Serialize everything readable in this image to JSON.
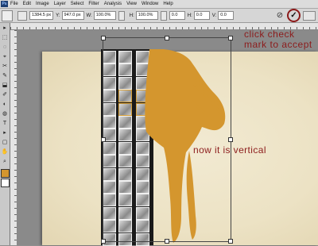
{
  "menubar": {
    "logo": "Ps",
    "items": [
      "File",
      "Edit",
      "Image",
      "Layer",
      "Select",
      "Filter",
      "Analysis",
      "View",
      "Window",
      "Help"
    ]
  },
  "options": {
    "x_value": "1384.5 px",
    "y_label": "Y:",
    "y_value": "947.0 px",
    "w_label": "W:",
    "w_value": "100.0%",
    "h_label": "H:",
    "h_value": "100.0%",
    "angle_value": "0.0",
    "h_skew_label": "H:",
    "h_skew_value": "0.0",
    "v_skew_label": "V:",
    "v_skew_value": "0.0",
    "cancel_glyph": "⊘",
    "commit_glyph": "✓"
  },
  "tools": [
    "▸",
    "⬚",
    "◌",
    "⌖",
    "✂",
    "✎",
    "⬓",
    "✐",
    "◐",
    "◍",
    "T",
    "▸",
    "▢",
    "✋",
    "⌕"
  ],
  "colors": {
    "foreground": "#d4962e",
    "background": "#ffffff",
    "accent": "#8c1c1c",
    "brush": "#d4962e"
  },
  "annotations": {
    "top": "click check mark to accept",
    "middle": "now it is vertical"
  }
}
